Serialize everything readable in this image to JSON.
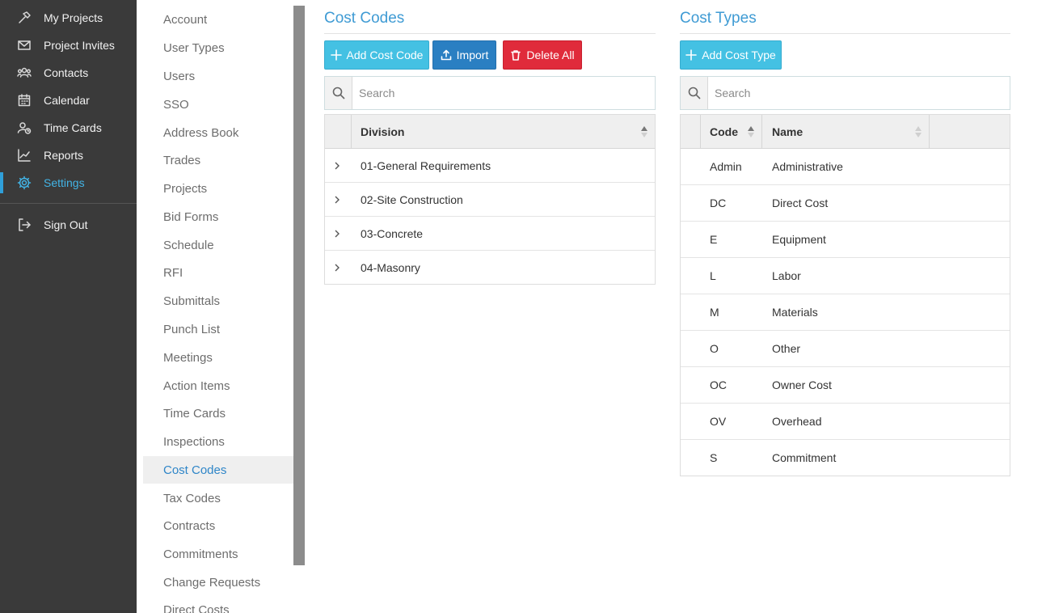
{
  "nav": {
    "items": [
      {
        "label": "My Projects",
        "icon": "hammer-icon"
      },
      {
        "label": "Project Invites",
        "icon": "envelope-icon"
      },
      {
        "label": "Contacts",
        "icon": "people-icon"
      },
      {
        "label": "Calendar",
        "icon": "calendar-icon"
      },
      {
        "label": "Time Cards",
        "icon": "user-clock-icon"
      },
      {
        "label": "Reports",
        "icon": "line-chart-icon"
      },
      {
        "label": "Settings",
        "icon": "gear-icon",
        "active": true
      }
    ],
    "sign_out": {
      "label": "Sign Out",
      "icon": "sign-out-icon"
    }
  },
  "settings_menu": {
    "items": [
      "Account",
      "User Types",
      "Users",
      "SSO",
      "Address Book",
      "Trades",
      "Projects",
      "Bid Forms",
      "Schedule",
      "RFI",
      "Submittals",
      "Punch List",
      "Meetings",
      "Action Items",
      "Time Cards",
      "Inspections",
      "Cost Codes",
      "Tax Codes",
      "Contracts",
      "Commitments",
      "Change Requests",
      "Direct Costs"
    ],
    "active": "Cost Codes"
  },
  "cost_codes": {
    "title": "Cost Codes",
    "buttons": {
      "add": "Add Cost Code",
      "import": "Import",
      "delete_all": "Delete All"
    },
    "search_placeholder": "Search",
    "columns": {
      "division": "Division"
    },
    "rows": [
      "01-General Requirements",
      "02-Site Construction",
      "03-Concrete",
      "04-Masonry"
    ]
  },
  "cost_types": {
    "title": "Cost Types",
    "buttons": {
      "add": "Add Cost Type"
    },
    "search_placeholder": "Search",
    "columns": {
      "code": "Code",
      "name": "Name"
    },
    "rows": [
      {
        "code": "Admin",
        "name": "Administrative"
      },
      {
        "code": "DC",
        "name": "Direct Cost"
      },
      {
        "code": "E",
        "name": "Equipment"
      },
      {
        "code": "L",
        "name": "Labor"
      },
      {
        "code": "M",
        "name": "Materials"
      },
      {
        "code": "O",
        "name": "Other"
      },
      {
        "code": "OC",
        "name": "Owner Cost"
      },
      {
        "code": "OV",
        "name": "Overhead"
      },
      {
        "code": "S",
        "name": "Commitment"
      }
    ]
  },
  "colors": {
    "accent": "#42b4e6",
    "title": "#3f9bd4",
    "danger": "#e02b3b",
    "nav_bg": "#3a3a3a"
  }
}
